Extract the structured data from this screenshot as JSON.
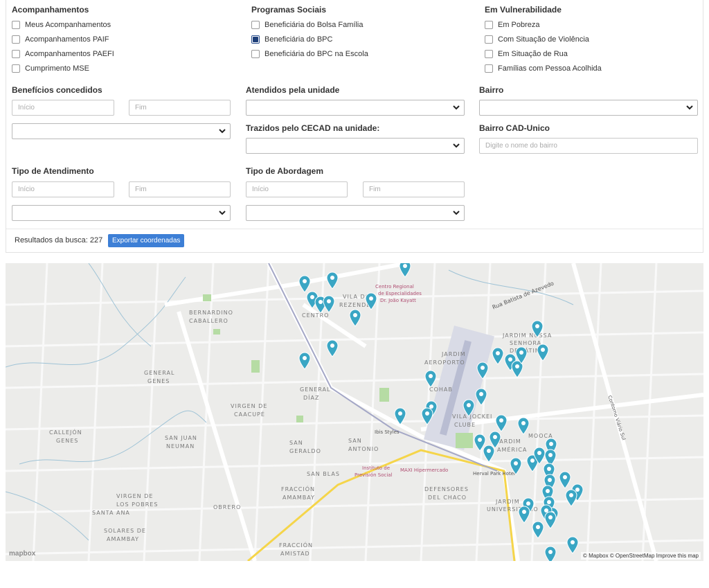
{
  "filters": {
    "acompanhamentos": {
      "title": "Acompanhamentos",
      "options": [
        {
          "label": "Meus Acompanhamentos",
          "checked": false
        },
        {
          "label": "Acompanhamentos PAIF",
          "checked": false
        },
        {
          "label": "Acompanhamentos PAEFI",
          "checked": false
        },
        {
          "label": "Cumprimento MSE",
          "checked": false
        }
      ]
    },
    "programas": {
      "title": "Programas Sociais",
      "options": [
        {
          "label": "Beneficiária do Bolsa Família",
          "checked": false
        },
        {
          "label": "Beneficiária do BPC",
          "checked": true
        },
        {
          "label": "Beneficiária do BPC na Escola",
          "checked": false
        }
      ]
    },
    "vulnerabilidade": {
      "title": "Em Vulnerabilidade",
      "options": [
        {
          "label": "Em Pobreza",
          "checked": false
        },
        {
          "label": "Com Situação de Violência",
          "checked": false
        },
        {
          "label": "Em Situação de Rua",
          "checked": false
        },
        {
          "label": "Famílias com Pessoa Acolhida",
          "checked": false
        }
      ]
    },
    "beneficios": {
      "title": "Benefícios concedidos",
      "start_placeholder": "Início",
      "end_placeholder": "Fim"
    },
    "atendidos": {
      "title": "Atendidos pela unidade"
    },
    "bairro": {
      "title": "Bairro"
    },
    "cecad": {
      "title": "Trazidos pelo CECAD na unidade:"
    },
    "bairro_cad": {
      "title": "Bairro CAD-Unico",
      "placeholder": "Digite o nome do bairro"
    },
    "tipo_atendimento": {
      "title": "Tipo de Atendimento",
      "start_placeholder": "Início",
      "end_placeholder": "Fim"
    },
    "tipo_abordagem": {
      "title": "Tipo de Abordagem",
      "start_placeholder": "Início",
      "end_placeholder": "Fim"
    }
  },
  "results": {
    "label": "Resultados da busca: 227",
    "export_button": "Exportar coordenadas"
  },
  "map": {
    "attribution": "© Mapbox © OpenStreetMap  Improve this map",
    "logo": "mapbox",
    "pin_color": "#3aa6c4",
    "labels": [
      "BERNARDINO",
      "CABALLERO",
      "GENERAL",
      "GENES",
      "VIRGEN DE",
      "CAACUPÉ",
      "CALLEJÓN",
      "GENES",
      "SAN JUAN",
      "NEUMAN",
      "SAN",
      "GERALDO",
      "SAN",
      "ANTONIO",
      "GENERAL",
      "DÍAZ",
      "SAN BLAS",
      "FRACCIÓN",
      "AMAMBAY",
      "OBRERO",
      "VIRGEN DE",
      "LOS POBRES",
      "SANTA ANA",
      "SOLARES DE",
      "AMAMBAY",
      "DEFENSORES",
      "DEL CHACO",
      "FRACCIÓN",
      "AMISTAD",
      "JARDIM",
      "AEROPORTO",
      "COHAB",
      "VILA JOCKEI",
      "CLUBE",
      "JARDIM",
      "AMÉRICA",
      "MOOCA",
      "JARDIM NOSSA",
      "SENHORA",
      "DE FÁTIMA",
      "JARDIM",
      "UNIVERSITÁRIO",
      "CENTRO",
      "VILA DO",
      "REZENDE",
      "Centro Regional",
      "de Especialidades",
      "Dr. João Kayatt",
      "Instituto de",
      "Previsión Social",
      "MAXI Hipermercado",
      "Herval Park Hotel",
      "Ibis Styles",
      "Contorno Viário Sul",
      "Rua Batista de Azevedo"
    ]
  }
}
